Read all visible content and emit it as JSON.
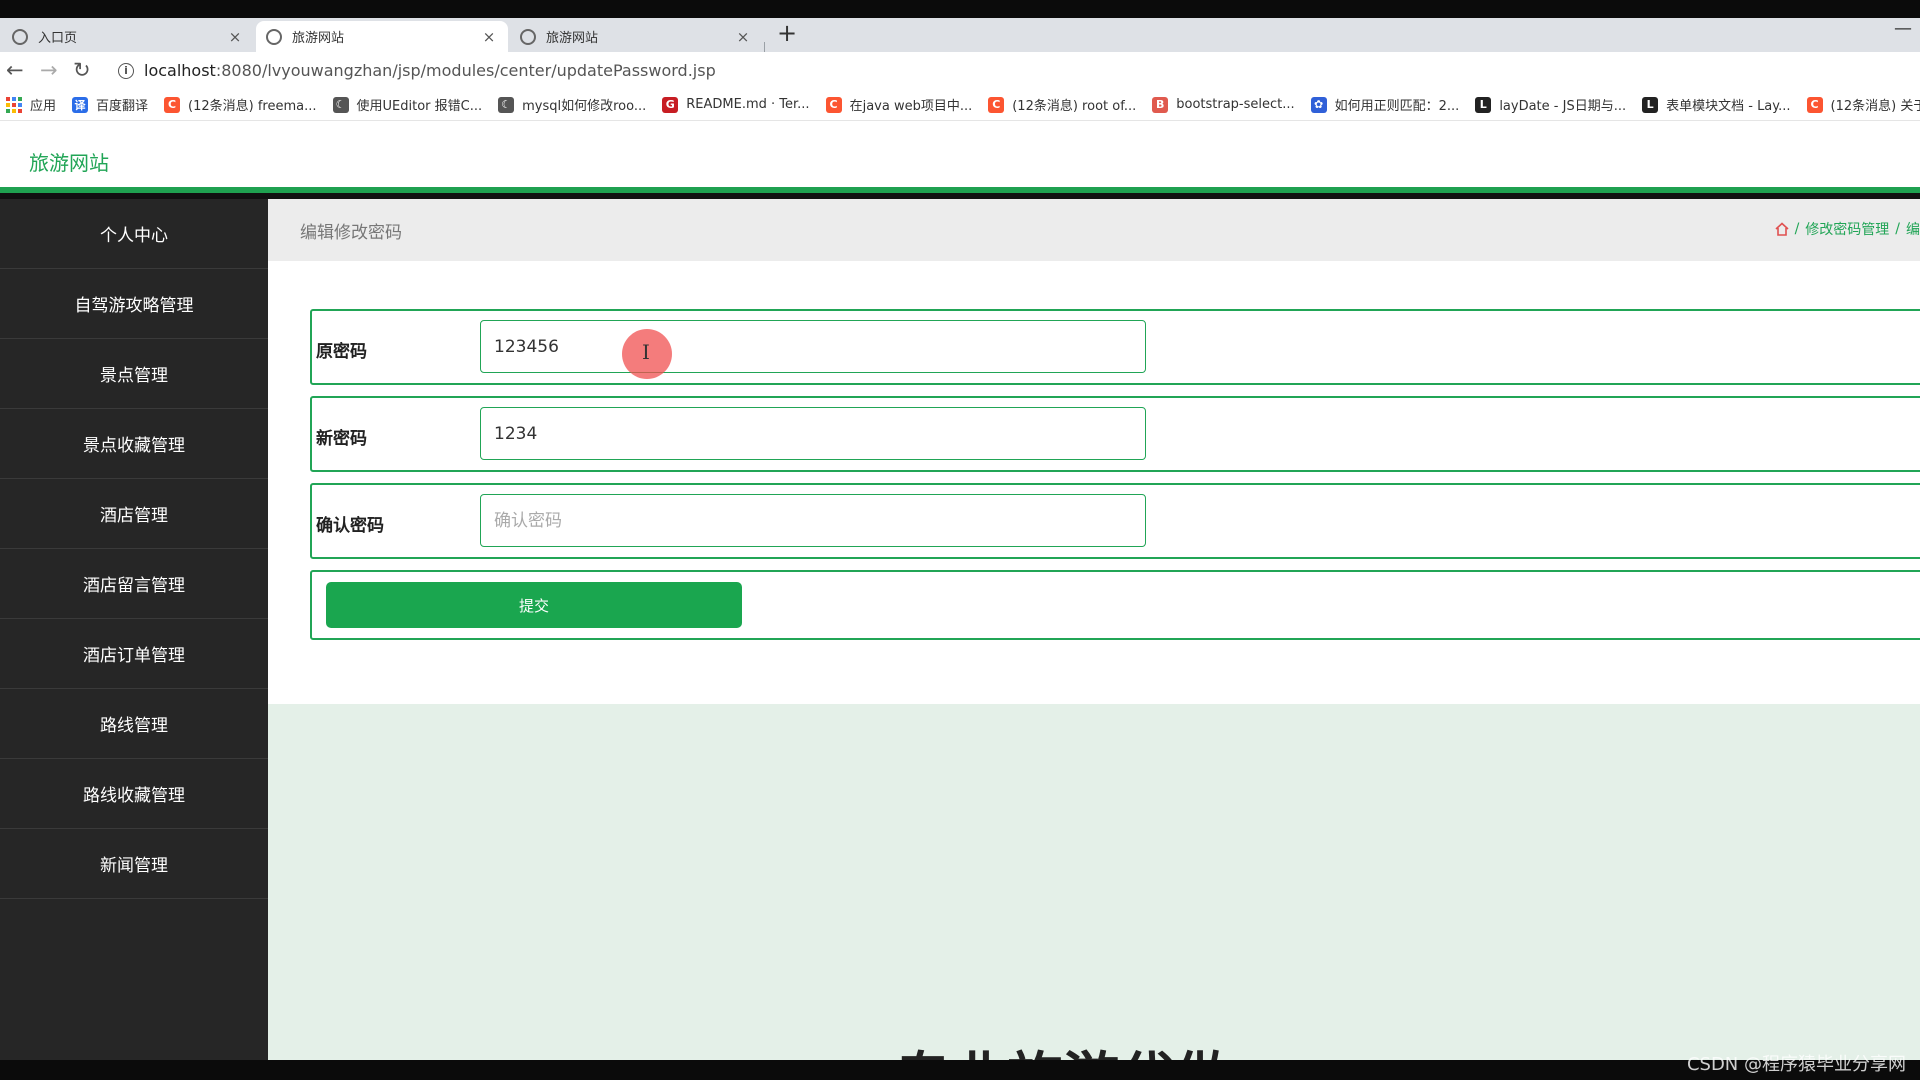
{
  "browser": {
    "tabs": [
      {
        "label": "入口页",
        "active": false
      },
      {
        "label": "旅游网站",
        "active": true
      },
      {
        "label": "旅游网站",
        "active": false
      }
    ],
    "new_tab": "+",
    "close_glyph": "×",
    "minimize_glyph": "—",
    "url_host": "localhost",
    "url_rest": ":8080/lvyouwangzhan/jsp/modules/center/updatePassword.jsp",
    "bookmarks": [
      {
        "label": "应用",
        "icon": "apps-grid-icon",
        "color": "#4285f4"
      },
      {
        "label": "百度翻译",
        "icon": "baidu-translate-icon",
        "color": "#2b6de8",
        "glyph": "译"
      },
      {
        "label": "(12条消息) freema...",
        "icon": "csdn-icon",
        "color": "#fc5531",
        "glyph": "C"
      },
      {
        "label": "使用UEditor 报错C...",
        "icon": "moon-icon",
        "color": "#555",
        "glyph": "☾"
      },
      {
        "label": "mysql如何修改roo...",
        "icon": "moon-icon",
        "color": "#555",
        "glyph": "☾"
      },
      {
        "label": "README.md · Ter...",
        "icon": "gitee-icon",
        "color": "#c71d23",
        "glyph": "G"
      },
      {
        "label": "在java web项目中...",
        "icon": "csdn-icon",
        "color": "#fc5531",
        "glyph": "C"
      },
      {
        "label": "(12条消息) root of...",
        "icon": "csdn-icon",
        "color": "#fc5531",
        "glyph": "C"
      },
      {
        "label": "bootstrap-select...",
        "icon": "bootstrap-icon",
        "color": "#e05a4e",
        "glyph": "B"
      },
      {
        "label": "如何用正则匹配：2...",
        "icon": "baidu-paw-icon",
        "color": "#3060d8",
        "glyph": "✿"
      },
      {
        "label": "layDate - JS日期与...",
        "icon": "layui-icon",
        "color": "#222",
        "glyph": "L"
      },
      {
        "label": "表单模块文档 - Lay...",
        "icon": "layui-icon",
        "color": "#222",
        "glyph": "L"
      },
      {
        "label": "(12条消息) 关于",
        "icon": "csdn-icon",
        "color": "#fc5531",
        "glyph": "C"
      }
    ]
  },
  "app": {
    "site_title": "旅游网站",
    "sidebar": [
      "个人中心",
      "自驾游攻略管理",
      "景点管理",
      "景点收藏管理",
      "酒店管理",
      "酒店留言管理",
      "酒店订单管理",
      "路线管理",
      "路线收藏管理",
      "新闻管理"
    ],
    "page_title": "编辑修改密码",
    "breadcrumb": {
      "sep": "/",
      "section": "修改密码管理",
      "current": "编"
    },
    "form": {
      "old_password_label": "原密码",
      "old_password_value": "123456",
      "new_password_label": "新密码",
      "new_password_value": "1234",
      "confirm_password_label": "确认密码",
      "confirm_password_placeholder": "确认密码",
      "submit_label": "提交"
    },
    "partial_heading": "专业旅游代做"
  },
  "watermark": "CSDN @程序猿毕业分享网",
  "colors": {
    "accent": "#1fa150",
    "sidebar_bg": "#262626",
    "main_bg": "#e4f0e8"
  }
}
